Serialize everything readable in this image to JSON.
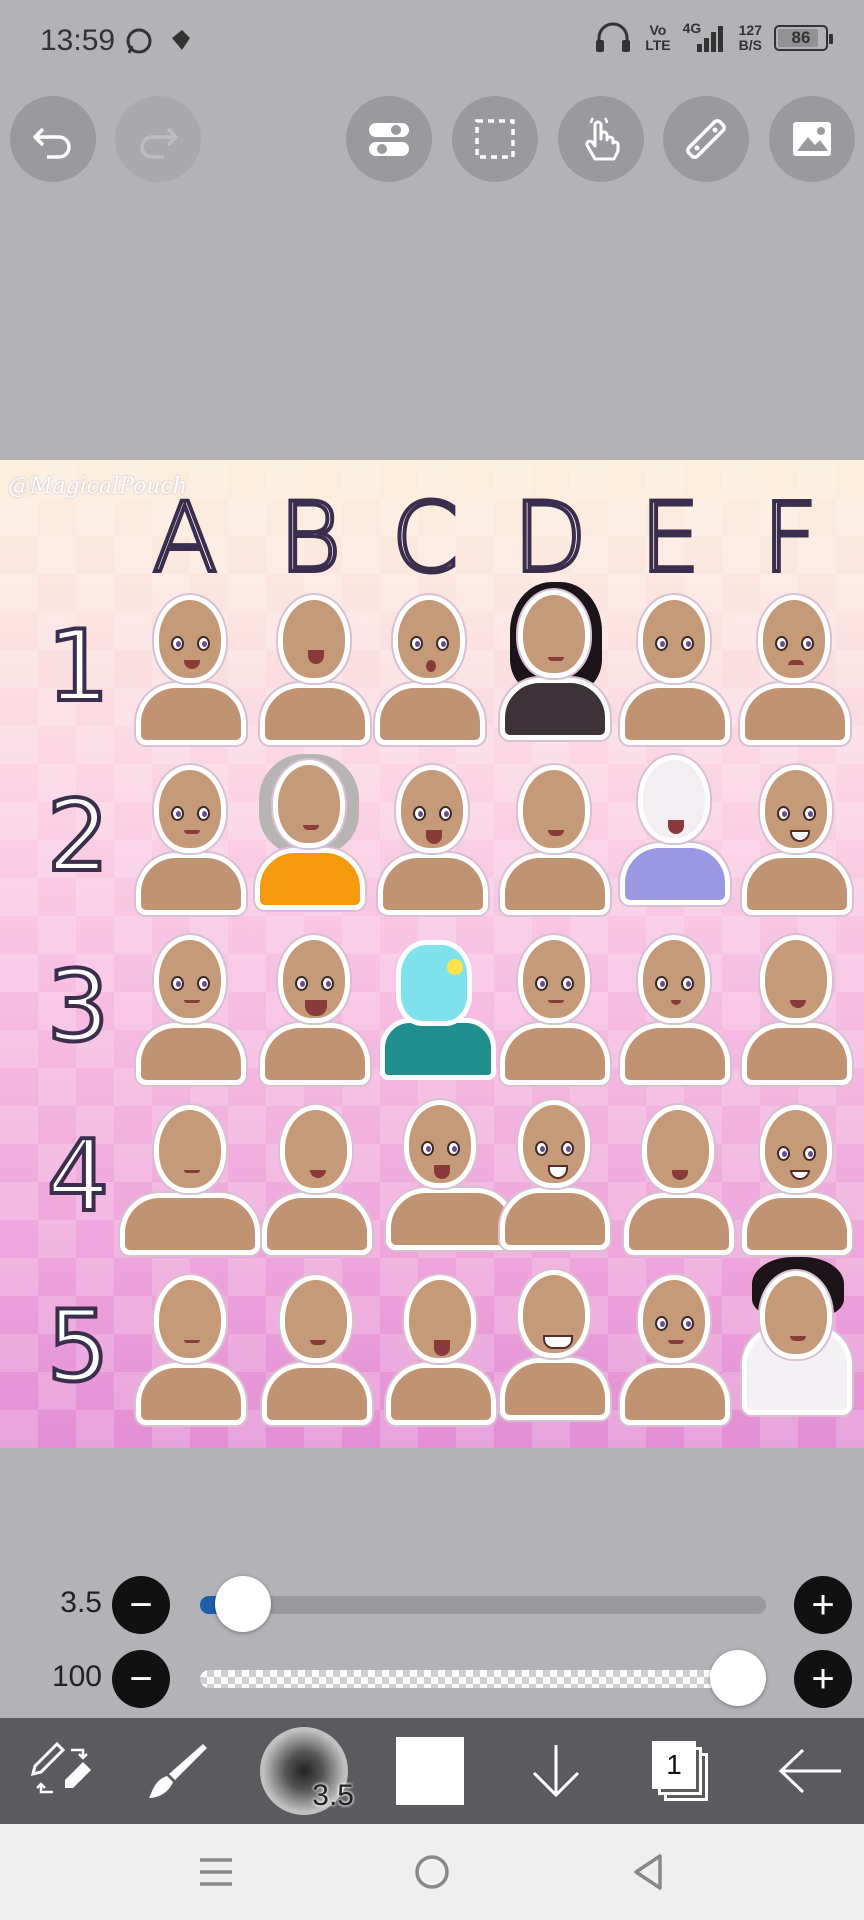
{
  "status_bar": {
    "time": "13:59",
    "network_top": "Vo",
    "network_bottom": "LTE",
    "signal_label": "4G",
    "speed_top": "127",
    "speed_bottom": "B/S",
    "battery": "86"
  },
  "toolbar": {
    "icons": [
      "undo-icon",
      "redo-icon",
      "toggle-settings-icon",
      "selection-icon",
      "hand-gesture-icon",
      "ruler-icon",
      "image-icon"
    ]
  },
  "canvas": {
    "watermark": "@MagicalPouch",
    "columns": [
      "A",
      "B",
      "C",
      "D",
      "E",
      "F"
    ],
    "rows": [
      "1",
      "2",
      "3",
      "4",
      "5"
    ]
  },
  "brush_size": {
    "value": "3.5",
    "level": 0.03
  },
  "opacity": {
    "value": "100",
    "level": 1.0
  },
  "bottom_toolbar": {
    "brush_size_label": "3.5",
    "layer_count": "1",
    "current_color": "#ffffff"
  },
  "colors": {
    "background": "#b3b2b7",
    "button_bg": "#9a999e",
    "bottom_bar": "#5b5a5f",
    "slider_accent": "#1d5fa8"
  }
}
